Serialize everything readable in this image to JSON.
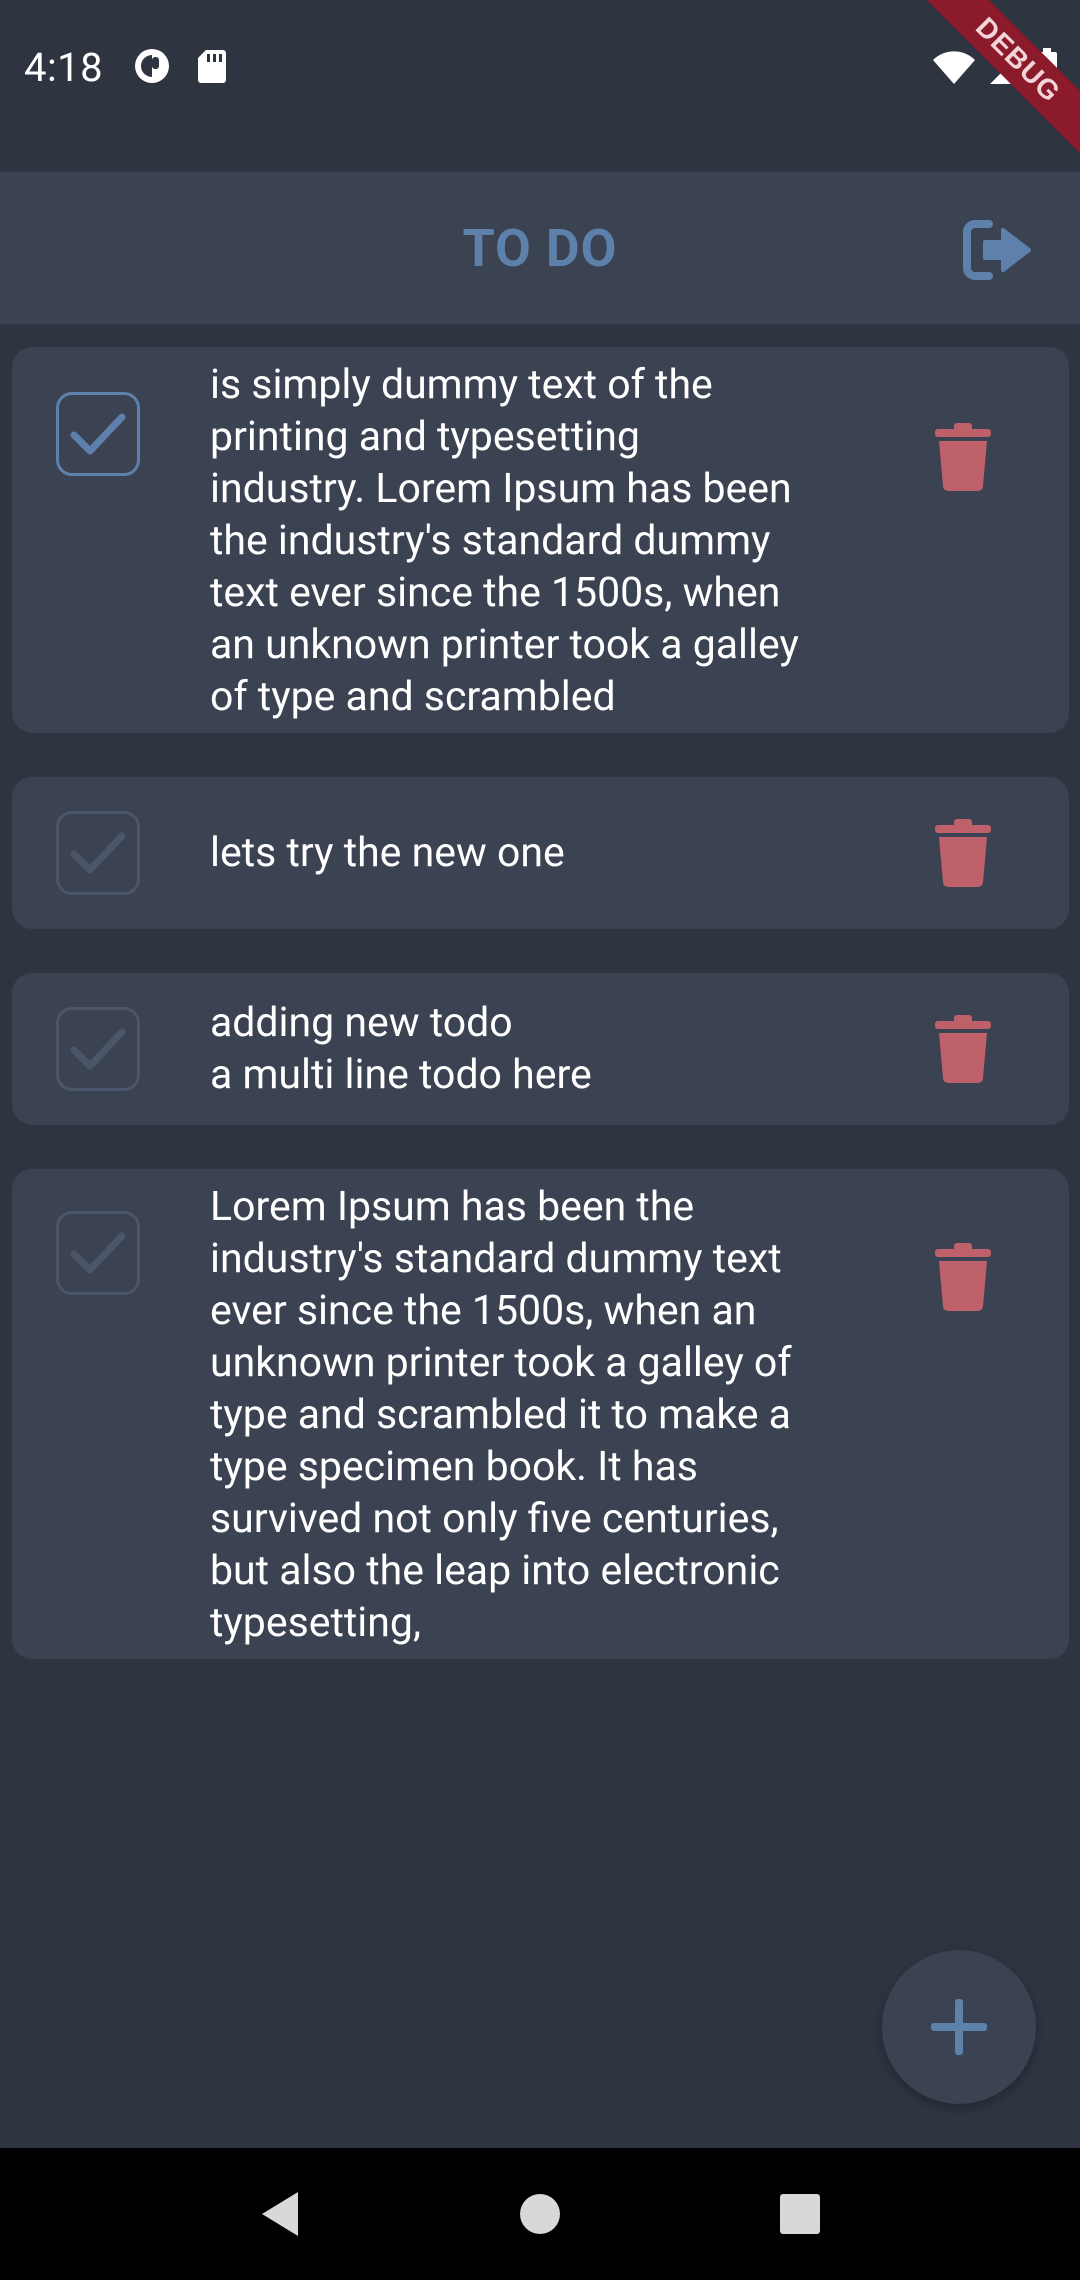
{
  "status_bar": {
    "time": "4:18",
    "left_icons": [
      "app-indicator-icon",
      "sd-card-icon"
    ],
    "right_icons": [
      "wifi-icon",
      "signal-icon",
      "battery-icon"
    ],
    "debug_label": "DEBUG"
  },
  "app_bar": {
    "title": "TO DO",
    "logout_icon": "logout-icon"
  },
  "todos": [
    {
      "text": "is simply dummy text of the\nprinting and typesetting\nindustry. Lorem Ipsum has been\nthe industry's standard dummy\ntext ever since the 1500s, when\nan unknown printer took a galley\nof type and scrambled",
      "done": true
    },
    {
      "text": "lets try the new one",
      "done": false
    },
    {
      "text": "adding new todo\na multi line todo here",
      "done": false
    },
    {
      "text": "Lorem Ipsum has been the\nindustry's standard dummy text\never since the 1500s, when an\nunknown printer took a galley of\ntype and scrambled it to make a\ntype specimen book. It has\nsurvived not only five centuries,\nbut also the leap into electronic\ntypesetting,",
      "done": false
    }
  ],
  "fab": {
    "icon": "plus-icon"
  },
  "nav_bar": {
    "buttons": [
      "back-icon",
      "home-icon",
      "recents-icon"
    ]
  },
  "colors": {
    "background": "#2e3440",
    "card": "#3b4252",
    "accent": "#5e81ac",
    "delete": "#bf616a",
    "unchecked_border": "#4c566a",
    "debug_banner": "#8b1a2b"
  }
}
